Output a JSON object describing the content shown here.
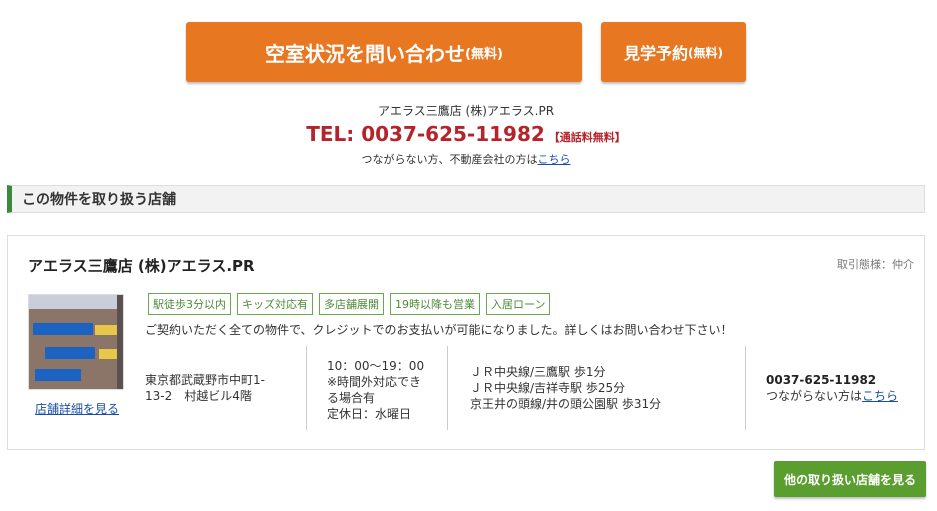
{
  "buttons": {
    "inquiry_main": "空室状況を問い合わせ",
    "inquiry_sub": "(無料)",
    "tour_main": "見学予約",
    "tour_sub": "(無料)",
    "other_shops": "他の取り扱い店舗を見る"
  },
  "contact": {
    "shop_name": "アエラス三鷹店 (株)アエラス.PR",
    "tel_label": "TEL: 0037-625-11982",
    "tel_free": "【通話料無料】",
    "noconnect_text": "つながらない方、不動産会社の方は",
    "noconnect_link": "こちら"
  },
  "section": {
    "title": "この物件を取り扱う店舗"
  },
  "shop": {
    "name": "アエラス三鷹店 (株)アエラス.PR",
    "transaction_type": "取引態様：仲介",
    "detail_link": "店舗詳細を見る",
    "tags": [
      "駅徒歩3分以内",
      "キッズ対応有",
      "多店舗展開",
      "19時以降も営業",
      "入居ローン"
    ],
    "credit_note": "ご契約いただく全ての物件で、クレジットでのお支払いが可能になりました。詳しくはお問い合わせ下さい！",
    "address_1": "東京都武蔵野市中町1-",
    "address_2": "13-2　村越ビル4階",
    "hours": "10：00〜19：00",
    "hours_note_1": "※時間外対応でき",
    "hours_note_2": "る場合有",
    "holiday": "定休日：水曜日",
    "stations": [
      "ＪＲ中央線/三鷹駅 歩1分",
      "ＪＲ中央線/吉祥寺駅 歩25分",
      "京王井の頭線/井の頭公園駅 歩31分"
    ],
    "phone": "0037-625-11982",
    "phone_note": "つながらない方は",
    "phone_note_link": "こちら"
  }
}
